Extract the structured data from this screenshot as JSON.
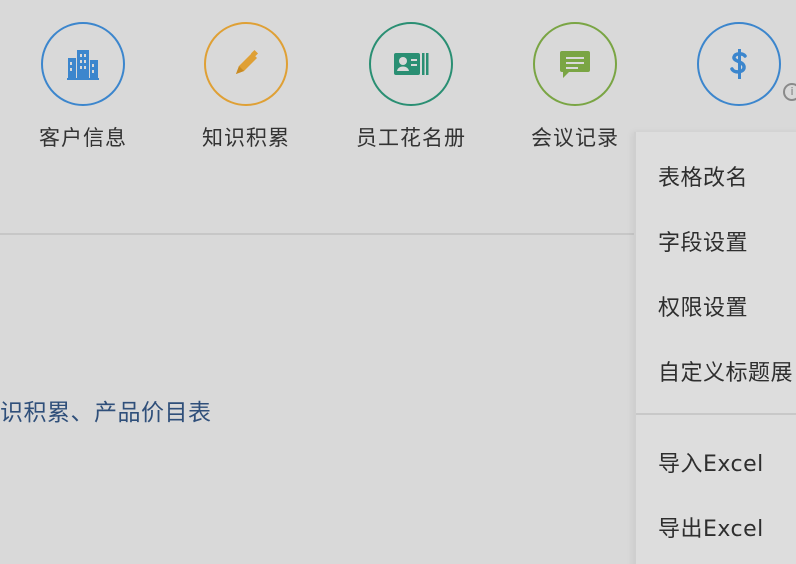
{
  "apps": [
    {
      "label": "客户信息",
      "icon": "building-icon",
      "color": "#3c86cd"
    },
    {
      "label": "知识积累",
      "icon": "pencil-icon",
      "color": "#dfa035"
    },
    {
      "label": "员工花名册",
      "icon": "id-card-icon",
      "color": "#2a8f73"
    },
    {
      "label": "会议记录",
      "icon": "chat-icon",
      "color": "#7aa544"
    },
    {
      "label": "",
      "icon": "dollar-icon",
      "color": "#3c86cd"
    }
  ],
  "section_text": "识积累、产品价目表",
  "menu": {
    "items": [
      "表格改名",
      "字段设置",
      "权限设置",
      "自定义标题展",
      "导入Excel",
      "导出Excel"
    ]
  }
}
